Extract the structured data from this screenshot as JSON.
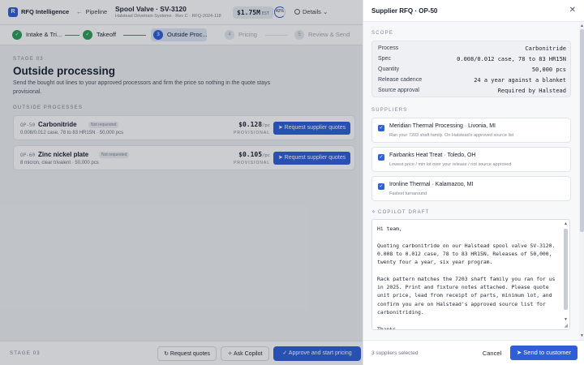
{
  "app": {
    "brand": "RFQ Intelligence",
    "logo_letter": "R",
    "back_link": "Pipeline",
    "doc_title": "Spool Valve · SV-3120",
    "doc_subtitle": "Halstead Drivetrain Systems · Rev C · RFQ-2024-118",
    "price": "$1.75M",
    "price_unit": "EST",
    "progress_label": "42%",
    "details_label": "Details"
  },
  "steps": [
    {
      "label": "Intake & Tri...",
      "num": "✓"
    },
    {
      "label": "Takeoff",
      "num": "✓"
    },
    {
      "label": "Outside Proc...",
      "num": "3"
    },
    {
      "label": "Pricing",
      "num": "4"
    },
    {
      "label": "Review & Send",
      "num": "5"
    }
  ],
  "stage": {
    "eyebrow": "STAGE 03",
    "title": "Outside processing",
    "description": "Send the bought out lines to your approved processors and firm the price so nothing in the quote stays provisional.",
    "section_label": "OUTSIDE PROCESSES"
  },
  "processes": [
    {
      "code": "OP-50",
      "name": "Carbonitride",
      "badge": "Not requested",
      "spec": "0.008/0.012 case, 78 to 83 HR15N · 50,000 pcs",
      "price": "$0.128",
      "unit": "/pc",
      "status": "PROVISIONAL",
      "button": "Request supplier quotes"
    },
    {
      "code": "OP-60",
      "name": "Zinc nickel plate",
      "badge": "Not requested",
      "spec": "8 micron, clear trivalent · 50,000 pcs",
      "price": "$0.105",
      "unit": "/pc",
      "status": "PROVISIONAL",
      "button": "Request supplier quotes"
    }
  ],
  "footer": {
    "stage": "STAGE 03",
    "request_quotes": "Request quotes",
    "ask_copilot": "Ask Copilot",
    "approve": "Approve and start pricing"
  },
  "drawer": {
    "title": "Supplier RFQ · OP-50",
    "scope_label": "SCOPE",
    "scope": [
      {
        "k": "Process",
        "v": "Carbonitride"
      },
      {
        "k": "Spec",
        "v": "0.008/0.012 case, 78 to 83 HR15N"
      },
      {
        "k": "Quantity",
        "v": "50,000 pcs"
      },
      {
        "k": "Release cadence",
        "v": "24 a year against a blanket"
      },
      {
        "k": "Source approval",
        "v": "Required by Halstead"
      }
    ],
    "suppliers_label": "SUPPLIERS",
    "suppliers": [
      {
        "name": "Meridian Thermal Processing · Livonia, MI",
        "note": "Ran your 7203 shaft family. On Halstead's approved source list"
      },
      {
        "name": "Fairbanks Heat Treat · Toledo, OH",
        "note": "Lowest price / min lot over your release / not source approved"
      },
      {
        "name": "Ironline Thermal · Kalamazoo, MI",
        "note": "Fastest turnaround"
      }
    ],
    "draft_label": "COPILOT DRAFT",
    "draft_text": "Hi team,\n\nQuoting carbonitride on our Halstead spool valve SV-3120. 0.008 to 0.012 case, 78 to 83 HR15N. Releases of 50,000, twenty four a year, six year program.\n\nRack pattern matches the 7203 shaft family you ran for us in 2025. Print and fixture notes attached. Please quote unit price, lead from receipt of parts, minimum lot, and confirm you are on Halstead's approved source list for carbonitriding.\n\nThanks",
    "count": "3 suppliers selected",
    "cancel": "Cancel",
    "send": "Send to customer"
  }
}
